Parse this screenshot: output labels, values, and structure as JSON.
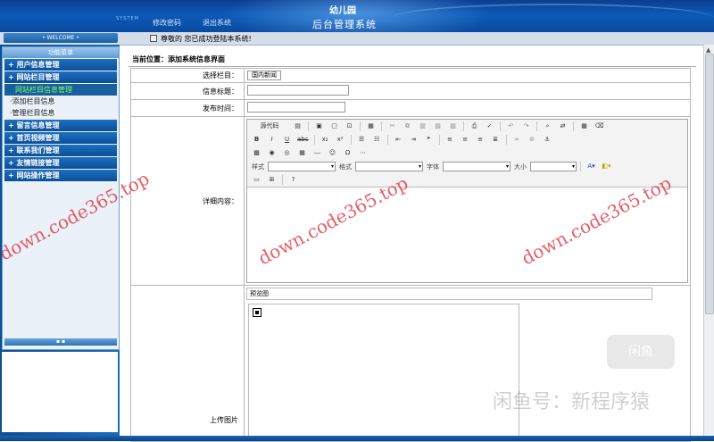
{
  "header": {
    "sys_tag": "SYSTEM",
    "nav_change_password": "修改密码",
    "nav_logout": "退出系统",
    "title_top": "幼儿园",
    "title_main": "后台管理系统"
  },
  "welcome": {
    "label": "• WELCOME •",
    "notice": "尊敬的 您已成功登陆本系统!"
  },
  "sidebar": {
    "head": "功能菜单",
    "menu1": "+ 用户信息管理",
    "menu2": "+ 网站栏目管理",
    "sub1": "网站栏目信息管理",
    "sub2": "·添加栏目信息",
    "sub3": "·管理栏目信息",
    "menu3": "+ 留言信息管理",
    "menu4": "+ 首页视频管理",
    "menu5": "+ 联系我们管理",
    "menu6": "+ 友情链接管理",
    "menu7": "+ 网站操作管理",
    "foot": "▪ ▪"
  },
  "main": {
    "breadcrumb": "当前位置：添加系统信息界面",
    "label_column": "选择栏目：",
    "column_value": "国内新闻",
    "label_title": "信息标题：",
    "label_time": "发布时间：",
    "label_content": "详细内容：",
    "label_image": "上传图片",
    "preview_title": "预览图"
  },
  "editor": {
    "source_label": "源代码",
    "style_label": "样式",
    "format_label": "格式",
    "font_label": "字体",
    "size_label": "大小",
    "bold": "B",
    "italic": "I",
    "underline": "U",
    "strike": "abc"
  },
  "watermark": {
    "text": "down.code365.top",
    "xianyu": "闲鱼号：新程序猿",
    "logo": "闲鱼"
  }
}
